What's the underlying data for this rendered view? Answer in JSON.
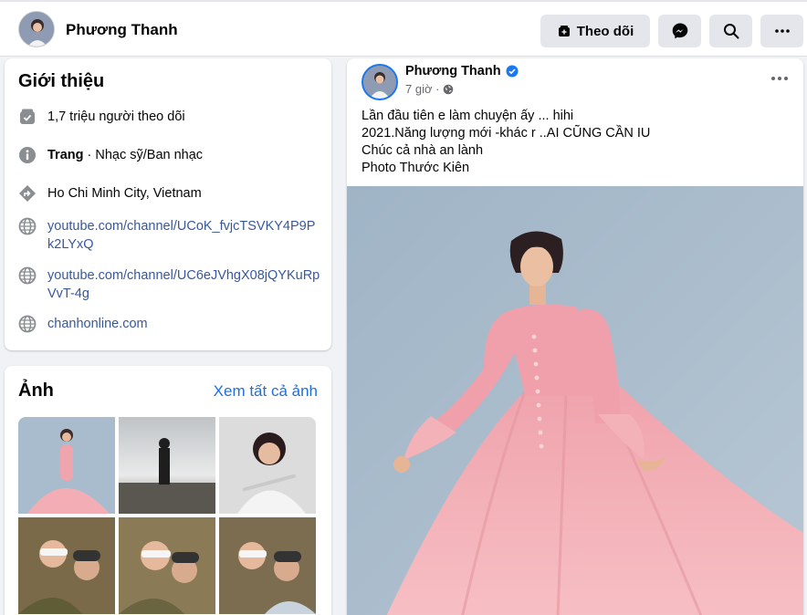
{
  "header": {
    "page_name": "Phương Thanh",
    "follow_label": "Theo dõi",
    "icons": [
      "follow-icon",
      "messenger-icon",
      "search-icon",
      "more-icon"
    ]
  },
  "intro": {
    "title": "Giới thiệu",
    "followers": "1,7 triệu người theo dõi",
    "page_type_label": "Trang",
    "page_type_value": " · Nhạc sỹ/Ban nhạc",
    "location": "Ho Chi Minh City, Vietnam",
    "links": [
      "youtube.com/channel/UCoK_fvjcTSVKY4P9Pk2LYxQ",
      "youtube.com/channel/UC6eJVhgX08jQYKuRpVvT-4g",
      "chanhonline.com"
    ]
  },
  "photos": {
    "title": "Ảnh",
    "see_all": "Xem tất cả ảnh"
  },
  "post": {
    "author": "Phương Thanh",
    "time": "7 giờ ·",
    "lines": [
      "Lần đầu tiên e làm chuyện ấy ... hihi",
      "2021.Năng lượng mới -khác r ..AI CŨNG CẦN IU",
      "Chúc cả nhà an lành",
      "Photo Thước Kiên"
    ]
  },
  "colors": {
    "link": "#385898",
    "accent": "#216fdb",
    "verified": "#1877f2",
    "background": "#f0f2f5",
    "dress_pink": "#f2aeb4",
    "backdrop": "#a9bccc"
  }
}
